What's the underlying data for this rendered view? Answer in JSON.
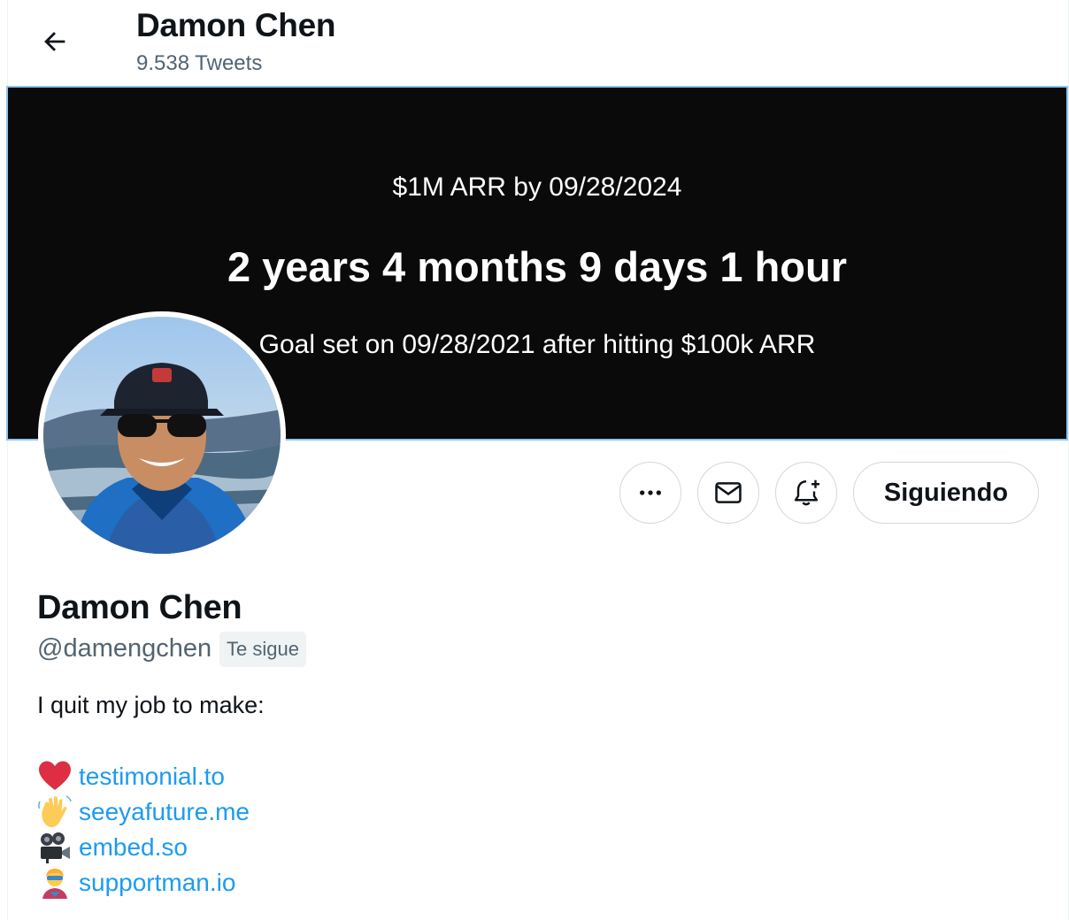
{
  "header": {
    "title": "Damon Chen",
    "tweet_count": "9.538 Tweets"
  },
  "banner": {
    "line1": "$1M ARR by 09/28/2024",
    "line2": "2 years 4 months 9 days 1 hour",
    "line3": "Goal set on 09/28/2021 after hitting $100k ARR"
  },
  "actions": {
    "more_icon": "more-horizontal-icon",
    "message_icon": "mail-icon",
    "notify_icon": "bell-plus-icon",
    "follow_label": "Siguiendo"
  },
  "profile": {
    "name": "Damon Chen",
    "handle": "@damengchen",
    "follows_you": "Te sigue",
    "bio": "I quit my job to make:",
    "links": [
      {
        "emoji": "heart-icon",
        "text": "testimonial.to"
      },
      {
        "emoji": "waving-hand-icon",
        "text": "seeyafuture.me"
      },
      {
        "emoji": "movie-camera-icon",
        "text": "embed.so"
      },
      {
        "emoji": "superhero-icon",
        "text": "supportman.io"
      }
    ]
  },
  "colors": {
    "link": "#1d9bf0",
    "secondary_text": "#536471",
    "banner_background": "#0a0a0a"
  }
}
